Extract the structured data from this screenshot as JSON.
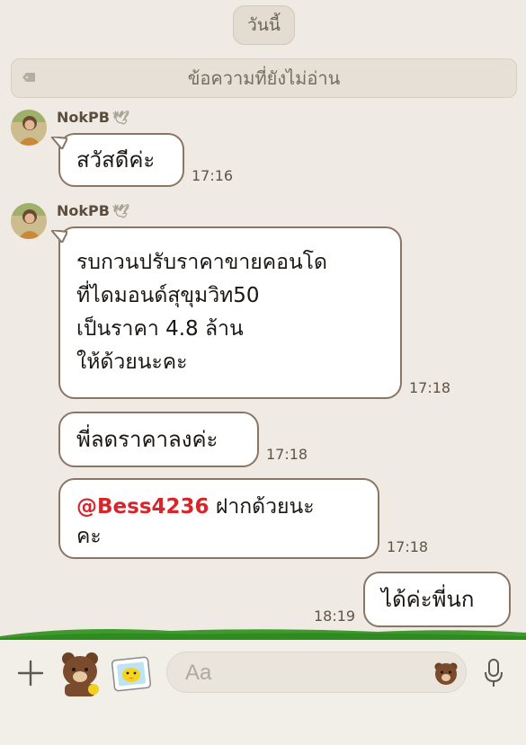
{
  "date_divider": "วันนี้",
  "unread_divider": "ข้อความที่ยังไม่อ่าน",
  "messages": [
    {
      "sender": "NokPB",
      "text": "สวัสดีค่ะ",
      "time": "17:16"
    },
    {
      "sender": "NokPB",
      "lines": [
        "รบกวนปรับราคาขายคอนโด",
        "ที่ไดมอนด์สุขุมวิท50",
        "เป็นราคา 4.8 ล้าน",
        "ให้ด้วยนะคะ"
      ],
      "time": "17:18"
    },
    {
      "text": "พี่ลดราคาลงค่ะ",
      "time": "17:18"
    },
    {
      "mention": "@Bess4236",
      "text_after": " ฝากด้วยนะ",
      "line2": "คะ",
      "time": "17:18"
    },
    {
      "text": "ได้ค่ะพี่นก",
      "time": "18:19",
      "outgoing": true
    }
  ],
  "composer": {
    "placeholder": "Aa"
  },
  "colors": {
    "background": "#efebe4",
    "bubble_border": "#8b7563",
    "mention": "#d7262b",
    "grass": "#3f9a2c"
  },
  "icons": [
    "tag-icon",
    "dove-icon",
    "plus-icon",
    "brown-bear-sticker-icon",
    "photo-sticker-icon",
    "bear-emoji-icon",
    "microphone-icon"
  ]
}
